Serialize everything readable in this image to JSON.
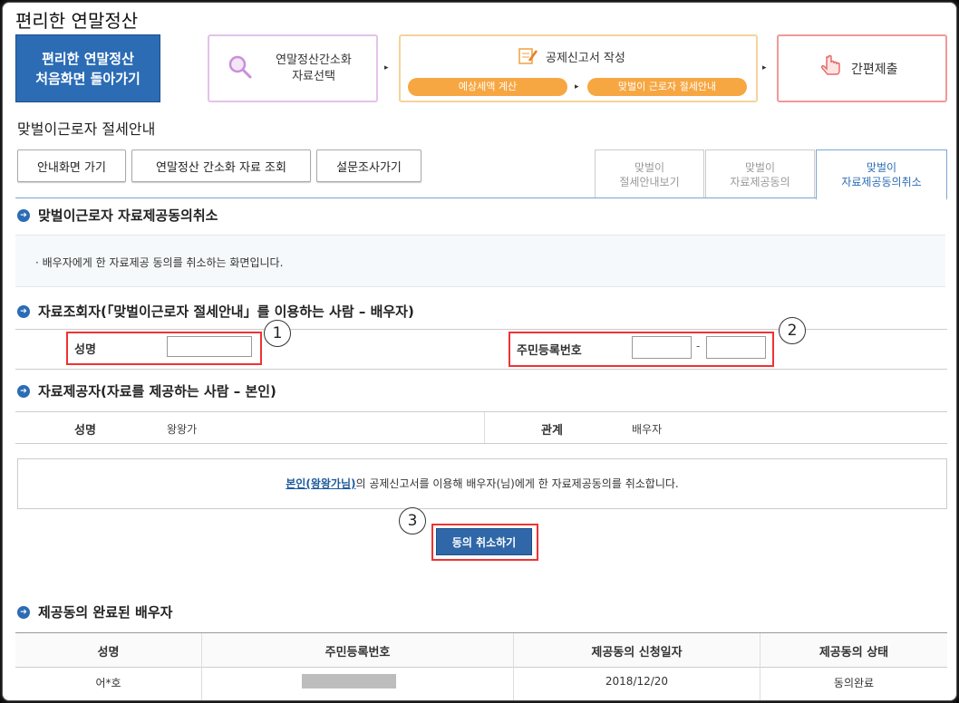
{
  "app": {
    "title": "편리한 연말정산"
  },
  "header": {
    "back_button": {
      "line1": "편리한 연말정산",
      "line2": "처음화면 돌아가기"
    },
    "step1": {
      "label": "연말정산간소화\n자료선택",
      "icon": "magnifier-icon"
    },
    "step2": {
      "title": "공제신고서 작성",
      "icon": "form-edit-icon",
      "pill1": "예상세액 계산",
      "pill2": "맞벌이 근로자 절세안내"
    },
    "step3": {
      "label": "간편제출",
      "icon": "hand-pointer-icon"
    }
  },
  "page": {
    "heading": "맞벌이근로자 절세안내"
  },
  "buttons": {
    "guide": "안내화면 가기",
    "simplified": "연말정산 간소화 자료 조회",
    "survey": "설문조사가기"
  },
  "tabs": [
    {
      "label": "맞벌이\n절세안내보기",
      "active": false
    },
    {
      "label": "맞벌이\n자료제공동의",
      "active": false
    },
    {
      "label": "맞벌이\n자료제공동의취소",
      "active": true
    }
  ],
  "section_cancel": {
    "title": "맞벌이근로자 자료제공동의취소",
    "notice": "배우자에게 한 자료제공 동의를 취소하는 화면입니다."
  },
  "section_viewer": {
    "title": "자료조회자(「맞벌이근로자 절세안내」를 이용하는 사람 – 배우자)",
    "name_label": "성명",
    "name_value": "",
    "ssn_label": "주민등록번호",
    "ssn_front": "",
    "ssn_dash": "-",
    "ssn_back": ""
  },
  "section_provider": {
    "title": "자료제공자(자료를 제공하는 사람 – 본인)",
    "name_label": "성명",
    "name_value": "왕왕가",
    "relation_label": "관계",
    "relation_value": "배우자"
  },
  "info": {
    "link_text": "본인(왕왕가님)",
    "rest_text": "의 공제신고서를 이용해 배우자(님)에게 한 자료제공동의를 취소합니다."
  },
  "cancel_button": {
    "label": "동의 취소하기"
  },
  "annotations": {
    "one": "1",
    "two": "2",
    "three": "3"
  },
  "section_completed": {
    "title": "제공동의 완료된 배우자",
    "columns": [
      "성명",
      "주민등록번호",
      "제공동의 신청일자",
      "제공동의 상태"
    ],
    "rows": [
      {
        "name": "어*호",
        "ssn": "",
        "date": "2018/12/20",
        "status": "동의완료"
      }
    ]
  },
  "colors": {
    "accent": "#2b6cb5",
    "highlight_red": "#e33333",
    "orange": "#f7a742"
  }
}
